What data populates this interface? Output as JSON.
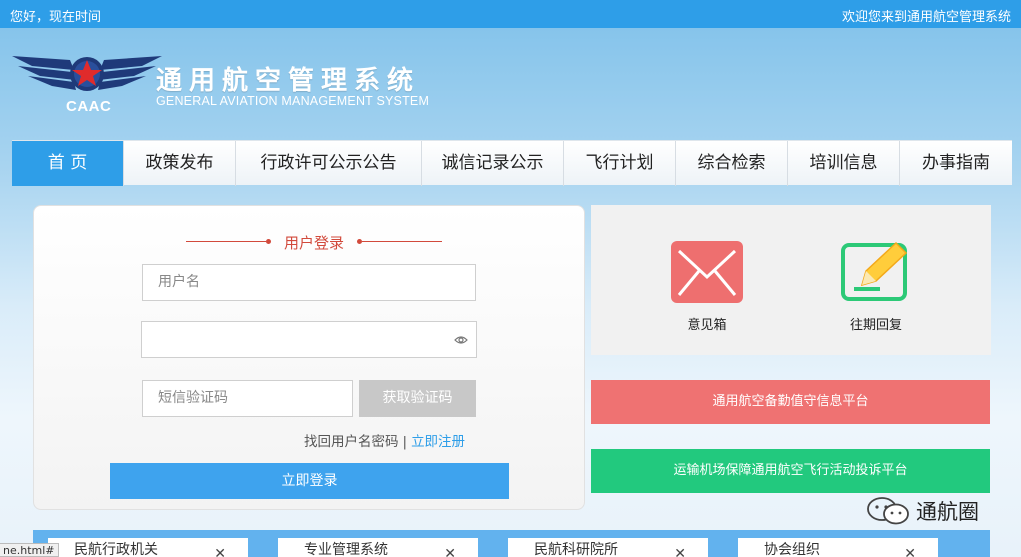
{
  "topbar": {
    "greeting": "您好，现在时间",
    "welcome": "欢迎您来到通用航空管理系统"
  },
  "header": {
    "logo_text": "CAAC",
    "title": "通用航空管理系统",
    "subtitle": "GENERAL AVIATION MANAGEMENT SYSTEM"
  },
  "nav": {
    "items": [
      {
        "label": "首 页"
      },
      {
        "label": "政策发布"
      },
      {
        "label": "行政许可公示公告"
      },
      {
        "label": "诚信记录公示"
      },
      {
        "label": "飞行计划"
      },
      {
        "label": "综合检索"
      },
      {
        "label": "培训信息"
      },
      {
        "label": "办事指南"
      }
    ]
  },
  "login": {
    "title": "用户登录",
    "username_placeholder": "用户名",
    "password_placeholder": "",
    "sms_placeholder": "短信验证码",
    "get_code": "获取验证码",
    "find_account": "找回用户名密码",
    "separator": "|",
    "register": "立即注册",
    "submit": "立即登录"
  },
  "quick": {
    "mailbox": "意见箱",
    "replies": "往期回复",
    "mailbox_color": "#ee6f6f",
    "replies_color": "#2cc977"
  },
  "platforms": {
    "duty": "通用航空备勤值守信息平台",
    "complaint": "运输机场保障通用航空飞行活动投诉平台",
    "duty_color": "#ef7272",
    "complaint_color": "#22c97e"
  },
  "dropdowns": [
    {
      "label": "民航行政机关"
    },
    {
      "label": "专业管理系统"
    },
    {
      "label": "民航科研院所"
    },
    {
      "label": "协会组织"
    }
  ],
  "status_text": "ne.html#",
  "watermark": "通航圈"
}
